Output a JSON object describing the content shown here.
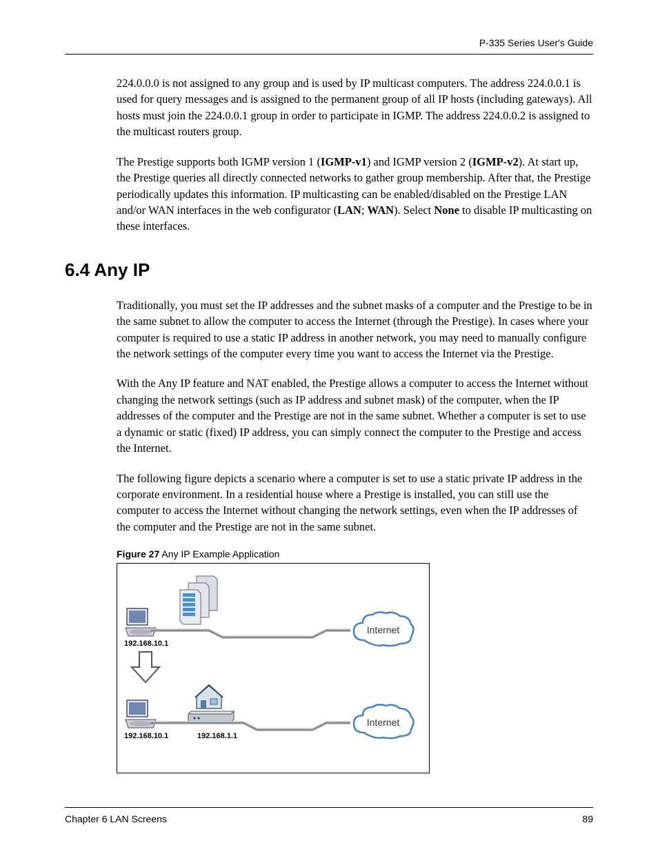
{
  "header": {
    "guide_title": "P-335 Series User's Guide"
  },
  "content": {
    "para1_text": "224.0.0.0 is not assigned to any group and is used by IP multicast computers. The address 224.0.0.1 is used for query messages and is assigned to the permanent group of all IP hosts (including gateways). All hosts must join the 224.0.0.1 group in order to participate in IGMP. The address 224.0.0.2 is assigned to the multicast routers group.",
    "para2_prefix": "The Prestige supports both IGMP version 1 (",
    "para2_bold1": "IGMP-v1",
    "para2_mid1": ") and IGMP version 2 (",
    "para2_bold2": "IGMP-v2",
    "para2_mid2": "). At start up, the Prestige queries all directly connected networks to gather group membership. After that, the Prestige periodically updates this information. IP multicasting can be enabled/disabled on the Prestige LAN and/or WAN interfaces in the web configurator (",
    "para2_bold3": "LAN",
    "para2_mid3": "; ",
    "para2_bold4": "WAN",
    "para2_mid4": "). Select ",
    "para2_bold5": "None",
    "para2_suffix": " to disable IP multicasting on these interfaces.",
    "section_heading": "6.4  Any IP",
    "para3_text": "Traditionally, you must set the IP addresses and the subnet masks of a computer and the Prestige to be in the same subnet to allow the computer to access the Internet (through the Prestige). In cases where your computer is required to use a static IP address in another network, you may need to manually configure the network settings of the computer every time you want to access the Internet via the Prestige.",
    "para4_text": "With the Any IP feature and NAT enabled, the Prestige allows a computer to access the Internet without changing the network settings (such as IP address and subnet mask) of the computer, when the IP addresses of the computer and the Prestige are not in the same subnet. Whether a computer is set to use a dynamic or static (fixed) IP address, you can simply connect the computer to the Prestige and access the Internet.",
    "para5_text": "The following figure depicts a scenario where a computer is set to use a static private IP address in the corporate environment. In a residential house where a Prestige is installed, you can still use the computer to access the Internet without changing the network settings, even when the IP addresses of the computer and the Prestige are not in the same subnet."
  },
  "figure": {
    "caption_bold": "Figure 27",
    "caption_text": "   Any IP Example Application",
    "ip1": "192.168.10.1",
    "ip2": "192.168.10.1",
    "ip3": "192.168.1.1",
    "cloud1_label": "Internet",
    "cloud2_label": "Internet"
  },
  "footer": {
    "chapter": "Chapter 6 LAN Screens",
    "page_number": "89"
  }
}
